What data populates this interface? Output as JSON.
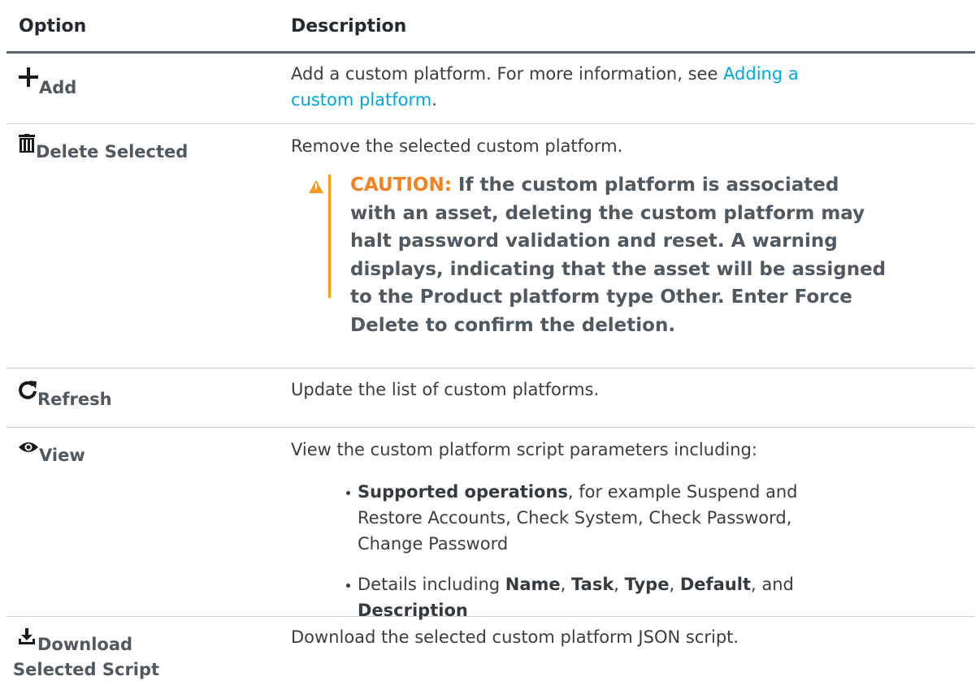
{
  "headers": {
    "option": "Option",
    "description": "Description"
  },
  "rows": {
    "add": {
      "icon": "plus-icon",
      "label": "Add",
      "desc_text": "Add a custom platform. For more information, see ",
      "desc_link_line1": "Adding a",
      "desc_link_line2": "custom platform",
      "desc_end": "."
    },
    "delete": {
      "icon": "trash-icon",
      "label": "Delete Selected",
      "desc": "Remove the selected custom platform.",
      "caution_label": "CAUTION:",
      "caution_lines": [
        "If the custom platform is associated",
        "with an asset, deleting the custom platform may",
        "halt password validation and reset. A warning",
        "displays, indicating that the asset will be assigned",
        "to the Product platform type Other. Enter Force",
        "Delete to confirm the deletion."
      ]
    },
    "refresh": {
      "icon": "refresh-icon",
      "label": "Refresh",
      "desc": "Update the list of custom platforms."
    },
    "view": {
      "icon": "eye-icon",
      "label": "View",
      "desc": "View the custom platform script parameters including:",
      "bullet1_bold": "Supported operations",
      "bullet1_line1": ", for example Suspend and",
      "bullet1_line2": "Restore Accounts, Check System, Check Password,",
      "bullet1_line3": "Change Password",
      "bullet2_start": "Details including ",
      "bullet2_name": "Name",
      "bullet2_sep1": ", ",
      "bullet2_task": "Task",
      "bullet2_sep2": ", ",
      "bullet2_type": "Type",
      "bullet2_sep3": ", ",
      "bullet2_default": "Default",
      "bullet2_and": ", and",
      "bullet2_description": "Description"
    },
    "download": {
      "icon": "download-icon",
      "label_line1": "Download",
      "label_line2": "Selected Script",
      "desc": "Download the selected custom platform JSON script."
    }
  }
}
